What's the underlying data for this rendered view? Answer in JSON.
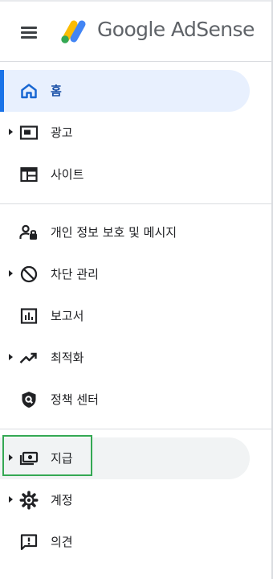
{
  "header": {
    "brand_text": "Google AdSense",
    "menu_icon": "hamburger-menu-icon",
    "logo_icon": "adsense-logo-icon"
  },
  "nav": {
    "home": {
      "label": "홈",
      "icon": "home-icon",
      "state": "selected"
    },
    "ads": {
      "label": "광고",
      "icon": "ad-unit-icon",
      "expandable": true
    },
    "sites": {
      "label": "사이트",
      "icon": "web-layout-icon"
    },
    "privacy": {
      "label": "개인 정보 보호 및 메시지",
      "icon": "privacy-person-lock-icon"
    },
    "blocking": {
      "label": "차단 관리",
      "icon": "block-icon",
      "expandable": true
    },
    "reports": {
      "label": "보고서",
      "icon": "bar-chart-icon"
    },
    "optimization": {
      "label": "최적화",
      "icon": "trending-up-icon",
      "expandable": true
    },
    "policy": {
      "label": "정책 센터",
      "icon": "policy-shield-icon"
    },
    "payments": {
      "label": "지급",
      "icon": "payments-icon",
      "expandable": true,
      "state": "hovered"
    },
    "account": {
      "label": "계정",
      "icon": "gear-icon",
      "expandable": true
    },
    "feedback": {
      "label": "의견",
      "icon": "feedback-icon"
    }
  },
  "colors": {
    "accent": "#1a73e8",
    "active_background": "#e8f0fe",
    "hover_background": "#f1f3f4",
    "focus_outline": "#34a853",
    "text": "#202124",
    "divider": "#dadce0"
  }
}
